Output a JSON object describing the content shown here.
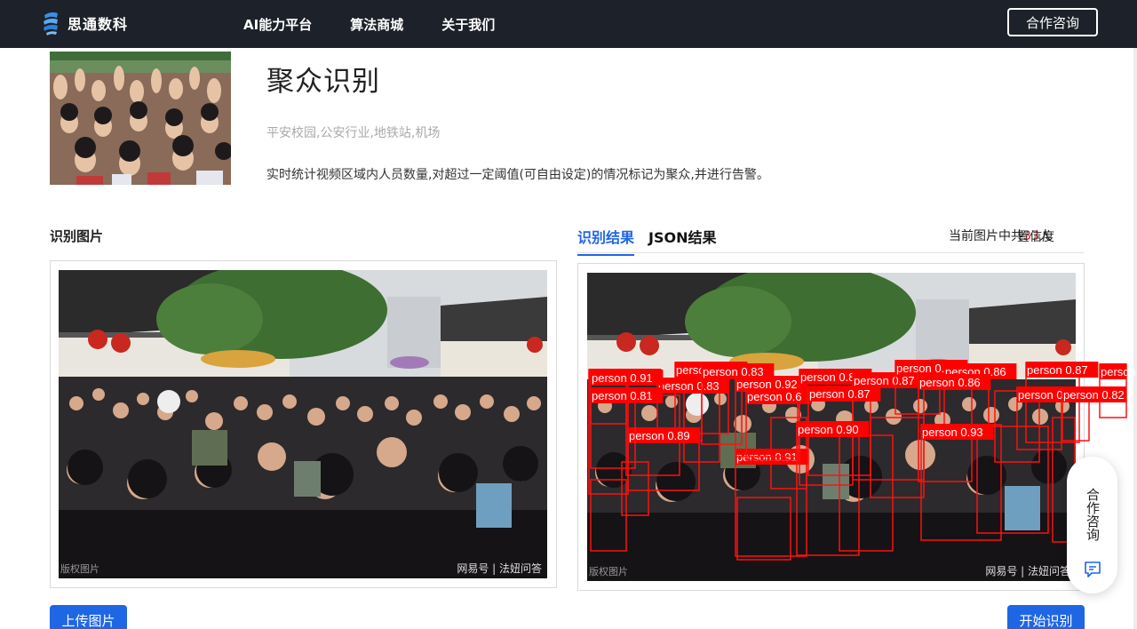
{
  "brand": {
    "name": "思通数科",
    "accent": "#1f66e5"
  },
  "nav": {
    "items": [
      "AI能力平台",
      "算法商城",
      "关于我们"
    ],
    "consult_label": "合作咨询"
  },
  "hero": {
    "title": "聚众识别",
    "tags": "平安校园,公安行业,地铁站,机场",
    "description": "实时统计视频区域内人员数量,对超过一定阈值(可自由设定)的情况标记为聚众,并进行告警。"
  },
  "left_panel": {
    "label": "识别图片",
    "watermark": "版权图片",
    "source": "网易号 | 法妞问答"
  },
  "right_panel": {
    "tabs": [
      "识别结果",
      "JSON结果"
    ],
    "count_prefix": "当前图片中共",
    "count_value": "33",
    "count_suffix": "人",
    "confidence_label": "置信度",
    "watermark": "版权图片",
    "source": "网易号 | 法妞问答"
  },
  "buttons": {
    "upload": "上传图片",
    "start": "开始识别"
  },
  "float_widget": {
    "label": "合作咨询",
    "icon": "chat-icon"
  },
  "detections": [
    {
      "label": "person",
      "score": "0.91"
    },
    {
      "label": "person",
      "score": "0.90"
    },
    {
      "label": "person",
      "score": "0.83"
    },
    {
      "label": "person",
      "score": "0.83"
    },
    {
      "label": "person",
      "score": "0.91"
    },
    {
      "label": "person",
      "score": "0.92"
    },
    {
      "label": "person",
      "score": "0.88"
    },
    {
      "label": "person",
      "score": "0.6"
    },
    {
      "label": "person",
      "score": "0.87"
    },
    {
      "label": "person",
      "score": "0.87"
    },
    {
      "label": "person",
      "score": "0.82"
    },
    {
      "label": "person",
      "score": "0.86"
    },
    {
      "label": "person",
      "score": "0.86"
    },
    {
      "label": "person",
      "score": "0.87"
    },
    {
      "label": "person",
      "score": "0.76"
    },
    {
      "label": "person",
      "score": "0.84"
    },
    {
      "label": "person",
      "score": "0.82"
    },
    {
      "label": "person",
      "score": "0.90"
    },
    {
      "label": "person",
      "score": "0.93"
    },
    {
      "label": "person",
      "score": "0.89"
    },
    {
      "label": "person",
      "score": "0.91"
    },
    {
      "label": "person",
      "score": "0.81"
    }
  ]
}
